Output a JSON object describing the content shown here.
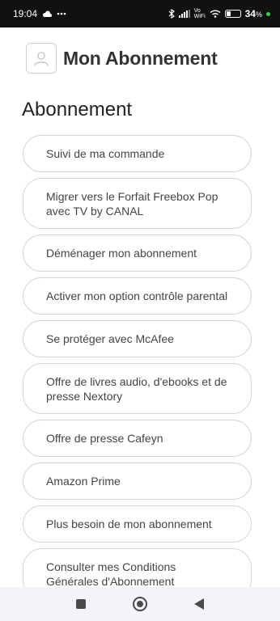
{
  "status_bar": {
    "time": "19:04",
    "network_label_top": "Vo",
    "network_label_bottom": "WiFi",
    "battery": "34",
    "battery_unit": "%",
    "battery_level": 0.34,
    "icons": [
      "cloud-icon",
      "more-dots-icon",
      "bluetooth-icon",
      "signal-icon",
      "wifi-icon",
      "battery-icon",
      "charging-dot-icon"
    ]
  },
  "header": {
    "title": "Mon Abonnement",
    "avatar_icon": "user-avatar-icon"
  },
  "section": {
    "title": "Abonnement"
  },
  "menu": {
    "items": [
      {
        "label": "Suivi de ma commande"
      },
      {
        "label": "Migrer vers le Forfait Freebox Pop avec TV by CANAL"
      },
      {
        "label": "Déménager mon abonnement"
      },
      {
        "label": "Activer mon option contrôle parental"
      },
      {
        "label": "Se protéger avec McAfee"
      },
      {
        "label": "Offre de livres audio, d'ebooks et de presse Nextory"
      },
      {
        "label": "Offre de presse Cafeyn"
      },
      {
        "label": "Amazon Prime"
      },
      {
        "label": "Plus besoin de mon abonnement"
      },
      {
        "label": "Consulter mes Conditions Générales d'Abonnement"
      }
    ]
  },
  "nav_bar": {
    "icons": [
      "recent-apps-icon",
      "home-icon",
      "back-icon"
    ]
  },
  "colors": {
    "status_bar_bg": "#111111",
    "text": "#444444",
    "border": "#d5d5d5",
    "nav_bg": "#f2f4f7",
    "charging": "#35d24a"
  }
}
